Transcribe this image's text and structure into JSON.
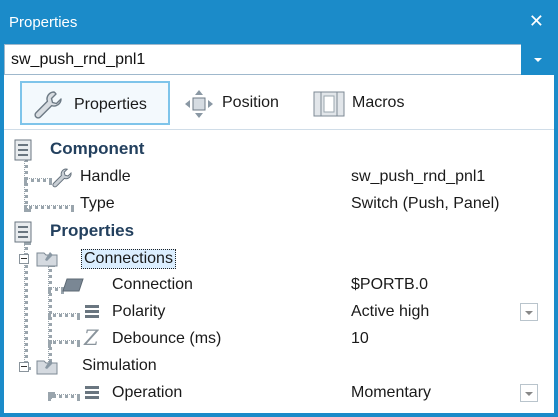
{
  "window": {
    "title": "Properties",
    "close_glyph": "✕"
  },
  "object_selector": {
    "value": "sw_push_rnd_pnl1"
  },
  "tabs": [
    {
      "label": "Properties",
      "icon": "wrench-icon",
      "active": true
    },
    {
      "label": "Position",
      "icon": "move-arrows-icon",
      "active": false
    },
    {
      "label": "Macros",
      "icon": "macros-icon",
      "active": false
    }
  ],
  "sections": {
    "component": {
      "label": "Component",
      "handle": {
        "name": "Handle",
        "value": "sw_push_rnd_pnl1"
      },
      "type": {
        "name": "Type",
        "value": "Switch (Push, Panel)"
      }
    },
    "properties": {
      "label": "Properties",
      "connections": {
        "label": "Connections",
        "connection": {
          "name": "Connection",
          "value": "$PORTB.0"
        },
        "polarity": {
          "name": "Polarity",
          "value": "Active high"
        },
        "debounce": {
          "name": "Debounce (ms)",
          "value": "10"
        }
      },
      "simulation": {
        "label": "Simulation",
        "operation": {
          "name": "Operation",
          "value": "Momentary"
        }
      }
    }
  },
  "colors": {
    "accent": "#1b8bc9",
    "category_text": "#23405e",
    "selection_bg": "#dbeeff"
  }
}
